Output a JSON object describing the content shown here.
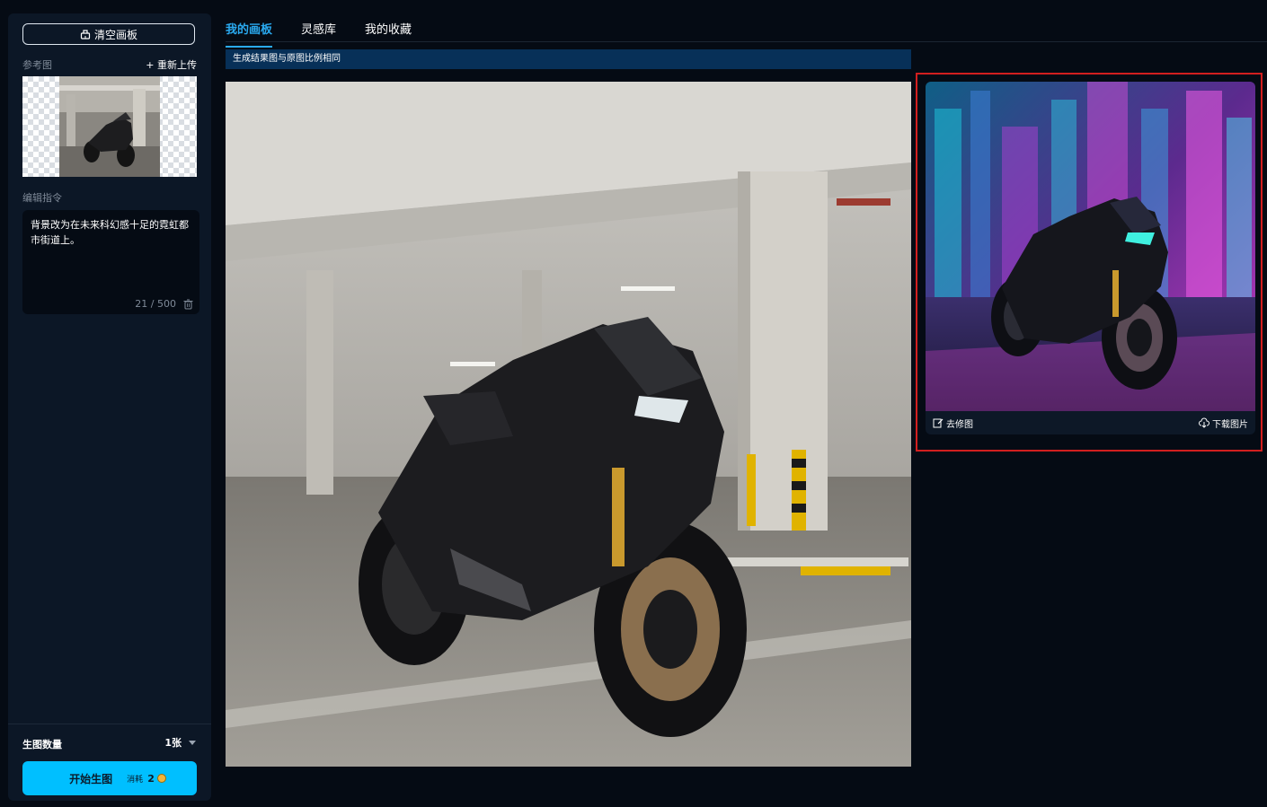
{
  "sidebar": {
    "clear_button": "清空画板",
    "reference_label": "参考图",
    "reupload_label": "+ 重新上传",
    "instruction_label": "编辑指令",
    "instruction_text": "背景改为在未来科幻感十足的霓虹都市街道上。",
    "instruction_count": "21 / 500",
    "quantity_label": "生图数量",
    "quantity_value": "1张",
    "start_button": "开始生图",
    "cost_label": "消耗",
    "cost_value": "2"
  },
  "tabs": [
    {
      "label": "我的画板",
      "active": true
    },
    {
      "label": "灵感库",
      "active": false
    },
    {
      "label": "我的收藏",
      "active": false
    }
  ],
  "notice": "生成结果图与原图比例相同",
  "result": {
    "remove_watermark": "去修图",
    "download": "下载图片"
  },
  "colors": {
    "accent": "#00bfff",
    "tab_active": "#2aaaf0",
    "highlight": "#d21f1f",
    "notice_bg": "#073058"
  }
}
